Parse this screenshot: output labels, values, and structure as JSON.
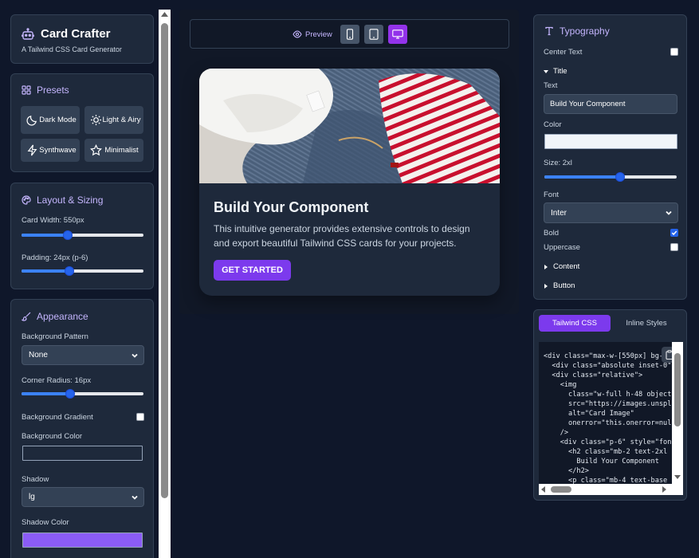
{
  "app": {
    "title": "Card Crafter",
    "subtitle": "A Tailwind CSS Card Generator"
  },
  "presets": {
    "title": "Presets",
    "items": [
      {
        "label": "Dark Mode",
        "icon": "moon-icon"
      },
      {
        "label": "Light & Airy",
        "icon": "sun-icon"
      },
      {
        "label": "Synthwave",
        "icon": "bolt-icon"
      },
      {
        "label": "Minimalist",
        "icon": "star-icon"
      }
    ]
  },
  "layout": {
    "title": "Layout & Sizing",
    "card_width_label": "Card Width: 550px",
    "card_width_value": 0.38,
    "padding_label": "Padding: 24px (p-6)",
    "padding_value": 0.39
  },
  "appearance": {
    "title": "Appearance",
    "bg_pattern_label": "Background Pattern",
    "bg_pattern_value": "None",
    "corner_radius_label": "Corner Radius: 16px",
    "corner_radius_value": 0.4,
    "bg_gradient_label": "Background Gradient",
    "bg_gradient_checked": false,
    "bg_color_label": "Background Color",
    "bg_color_value": "#1e293b",
    "shadow_label": "Shadow",
    "shadow_value": "lg",
    "shadow_color_label": "Shadow Color",
    "shadow_color_value": "#8b5cf6"
  },
  "preview": {
    "label": "Preview",
    "card": {
      "title": "Build Your Component",
      "body": "This intuitive generator provides extensive controls to design and export beautiful Tailwind CSS cards for your projects.",
      "button": "GET STARTED"
    }
  },
  "typography": {
    "title": "Typography",
    "center_text_label": "Center Text",
    "center_text_checked": false,
    "title_section": "Title",
    "text_label": "Text",
    "text_value": "Build Your Component",
    "color_label": "Color",
    "color_value": "#f1f5f9",
    "size_label": "Size: 2xl",
    "size_value": 0.57,
    "font_label": "Font",
    "font_value": "Inter",
    "bold_label": "Bold",
    "bold_checked": true,
    "uppercase_label": "Uppercase",
    "uppercase_checked": false,
    "content_section": "Content",
    "button_section": "Button"
  },
  "code": {
    "tab_tailwind": "Tailwind CSS",
    "tab_inline": "Inline Styles",
    "lines": [
      "<div class=\"max-w-[550px] bg-",
      "  <div class=\"absolute inset-0\"",
      "  <div class=\"relative\">",
      "    <img",
      "      class=\"w-full h-48 object",
      "      src=\"https://images.unspl",
      "      alt=\"Card Image\"",
      "      onerror=\"this.onerror=nul",
      "    />",
      "    <div class=\"p-6\" style=\"fon",
      "      <h2 class=\"mb-2 text-2xl",
      "        Build Your Component",
      "      </h2>",
      "      <p class=\"mb-4 text-base"
    ]
  },
  "colors": {
    "accent": "#7c3aed",
    "panel": "#1e293b",
    "bg": "#0f172a"
  }
}
